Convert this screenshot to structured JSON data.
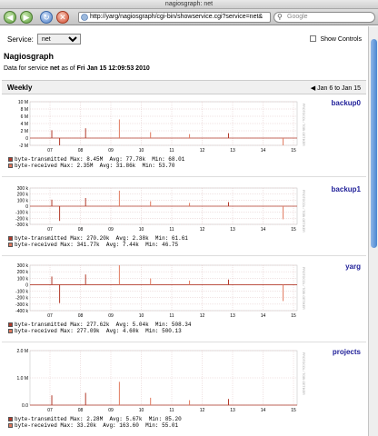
{
  "window": {
    "title": "nagiosgraph: net"
  },
  "toolbar": {
    "url": "http://yarg/nagiosgraph/cgi-bin/showservice.cgi?service=net&",
    "search_placeholder": "Google"
  },
  "controls": {
    "service_label": "Service:",
    "service_value": "net",
    "show_controls_label": "Show Controls"
  },
  "page": {
    "title": "Nagiosgraph",
    "data_prefix": "Data for service",
    "service_name": "net",
    "as_of": "as of",
    "timestamp": "Fri Jan 15 12:09:53 2010"
  },
  "period": {
    "label": "Weekly",
    "range": "Jan 6 to Jan 15"
  },
  "graphs": [
    {
      "host": "backup0",
      "side_label": "PROTOCOL / TOBI OETIKER",
      "yticks": [
        "10 M",
        "8 M",
        "6 M",
        "4 M",
        "2 M",
        "0",
        "-2 M"
      ],
      "xticks": [
        "07",
        "08",
        "09",
        "10",
        "11",
        "12",
        "13",
        "14",
        "15"
      ],
      "legend": [
        {
          "label": "byte-transmitted",
          "max": "8.45M",
          "avg": "77.78k",
          "min": "68.01",
          "color": "#b23a2a"
        },
        {
          "label": "byte-received",
          "max": "2.35M",
          "avg": "31.86k",
          "min": "53.70",
          "color": "#e07a5f"
        }
      ]
    },
    {
      "host": "backup1",
      "side_label": "PROTOCOL / TOBI OETIKER",
      "yticks": [
        "300 k",
        "200 k",
        "100 k",
        "0",
        "-100 k",
        "-200 k",
        "-300 k"
      ],
      "xticks": [
        "07",
        "08",
        "09",
        "10",
        "11",
        "12",
        "13",
        "14",
        "15"
      ],
      "legend": [
        {
          "label": "byte-transmitted",
          "max": "270.20k",
          "avg": "2.38k",
          "min": "61.61",
          "color": "#b23a2a"
        },
        {
          "label": "byte-received",
          "max": "341.77k",
          "avg": "7.44k",
          "min": "46.75",
          "color": "#e07a5f"
        }
      ]
    },
    {
      "host": "yarg",
      "side_label": "PROTOCOL / TOBI OETIKER",
      "yticks": [
        "300 k",
        "200 k",
        "100 k",
        "0",
        "-100 k",
        "-200 k",
        "-300 k",
        "-400 k"
      ],
      "xticks": [
        "07",
        "08",
        "09",
        "10",
        "11",
        "12",
        "13",
        "14",
        "15"
      ],
      "legend": [
        {
          "label": "byte-transmitted",
          "max": "277.62k",
          "avg": "5.04k",
          "min": "508.34",
          "color": "#b23a2a"
        },
        {
          "label": "byte-received",
          "max": "277.09k",
          "avg": "4.60k",
          "min": "500.13",
          "color": "#e07a5f"
        }
      ]
    },
    {
      "host": "projects",
      "side_label": "PROTOCOL / TOBI OETIKER",
      "yticks": [
        "2.0 M",
        "1.0 M",
        "0.0"
      ],
      "xticks": [
        "07",
        "08",
        "09",
        "10",
        "11",
        "12",
        "13",
        "14",
        "15"
      ],
      "legend": [
        {
          "label": "byte-transmitted",
          "max": "2.28M",
          "avg": "5.67k",
          "min": "85.20",
          "color": "#b23a2a"
        },
        {
          "label": "byte-received",
          "max": "33.20k",
          "avg": "163.60",
          "min": "55.01",
          "color": "#e07a5f"
        }
      ]
    }
  ],
  "legend_labels": {
    "max": "Max:",
    "avg": "Avg:",
    "min": "Min:"
  },
  "colors": {
    "transmitted": "#b23a2a",
    "received": "#e07a5f",
    "link": "#22229a",
    "grid": "#e2c7c7"
  }
}
